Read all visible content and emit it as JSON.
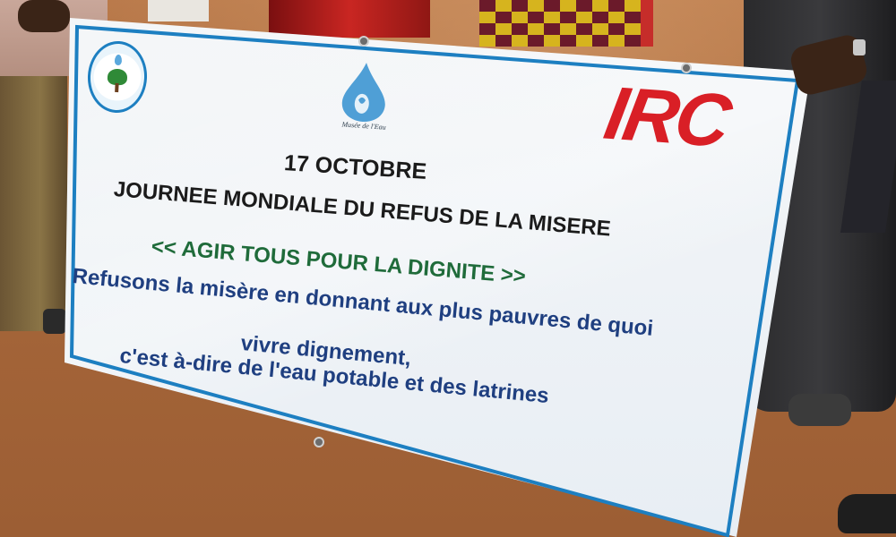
{
  "scene": {
    "description_colors": {
      "ground": "#a86a3c",
      "banner_background": "#eef2f6",
      "banner_border": "#1d7fc1",
      "irc_red": "#d91f26",
      "slogan_green": "#1f6b3a",
      "body_blue": "#1f3f80"
    }
  },
  "banner": {
    "logo_left_icon": "organization-seal-icon",
    "logo_center_icon": "water-drop-icon",
    "logo_center_caption": "Musée de l'Eau",
    "brand": "IRC",
    "date": "17 OCTOBRE",
    "event": "JOURNEE MONDIALE DU REFUS DE LA MISERE",
    "slogan": "<< AGIR TOUS POUR LA DIGNITE >>",
    "body_lines": [
      "Refusons la misère en donnant aux plus pauvres de quoi",
      "vivre dignement,",
      "c'est à-dire de l'eau potable et des latrines"
    ]
  }
}
